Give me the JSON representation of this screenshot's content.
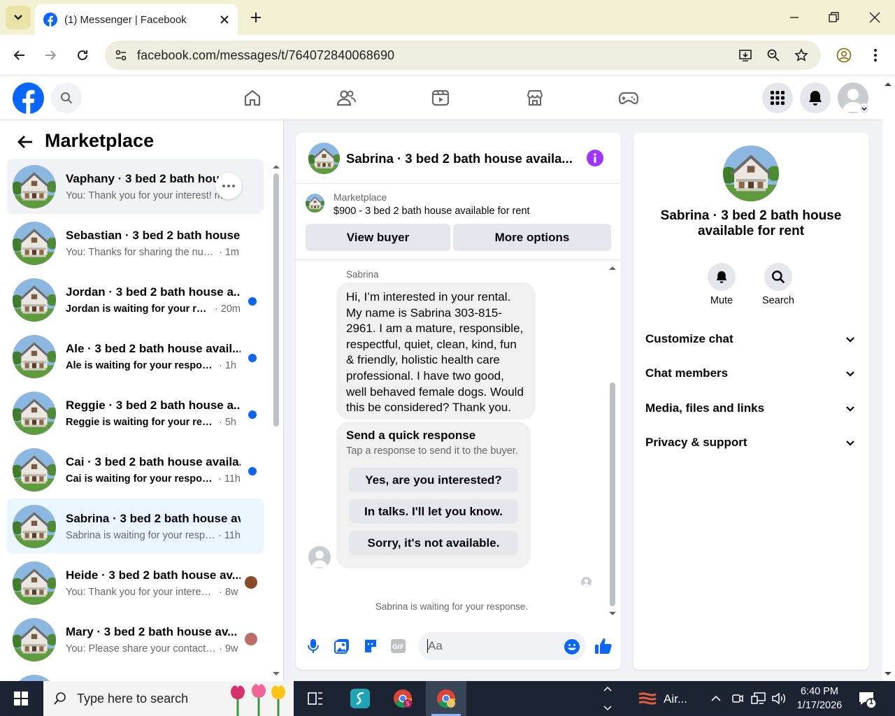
{
  "browser": {
    "tab_title": "(1) Messenger | Facebook",
    "url": "facebook.com/messages/t/764072840068690"
  },
  "sidebar": {
    "title": "Marketplace",
    "conversations": [
      {
        "name": "Vaphany · 3 bed 2 bath hous",
        "preview": "You: Thank you for your interest!",
        "time": "m",
        "unread": false
      },
      {
        "name": "Sebastian · 3 bed 2 bath house ...",
        "preview": "You: Thanks for sharing the numb...",
        "time": "· 1m",
        "unread": false
      },
      {
        "name": "Jordan · 3 bed 2 bath house a...",
        "preview": "Jordan is waiting for your res...",
        "time": "· 20m",
        "unread": true
      },
      {
        "name": "Ale · 3 bed 2 bath house avail...",
        "preview": "Ale is waiting for your response.",
        "time": "· 1h",
        "unread": true
      },
      {
        "name": "Reggie · 3 bed 2 bath house a...",
        "preview": "Reggie is waiting for your respo...",
        "time": "· 5h",
        "unread": true
      },
      {
        "name": "Cai · 3 bed 2 bath house availa...",
        "preview": "Cai is waiting for your response.",
        "time": "· 11h",
        "unread": true
      },
      {
        "name": "Sabrina · 3 bed 2 bath house av...",
        "preview": "Sabrina is waiting for your respon...",
        "time": "· 11h",
        "unread": false
      },
      {
        "name": "Heide · 3 bed 2 bath house av...",
        "preview": "You: Thank you for your interest...",
        "time": "· 8w",
        "unread": false
      },
      {
        "name": "Mary · 3 bed 2 bath house av...",
        "preview": "You: Please share your contact n...",
        "time": "· 9w",
        "unread": false
      }
    ]
  },
  "chat": {
    "header_title": "Sabrina · 3 bed 2 bath house availa...",
    "listing_label": "Marketplace",
    "listing_title": "$900 - 3 bed 2 bath house available for rent",
    "view_buyer": "View buyer",
    "more_options": "More options",
    "sender": "Sabrina",
    "message": "Hi, I’m interested in your rental. My name is Sabrina 303-815-2961.  I am a mature, responsible, respectful, quiet, clean, kind, fun & friendly, holistic health care professional. I have two good, well behaved female dogs. Would this be considered? Thank you.",
    "quick_title": "Send a quick response",
    "quick_sub": "Tap a response to send it to the buyer.",
    "quick_replies": [
      "Yes, are you interested?",
      "In talks. I'll let you know.",
      "Sorry, it's not available."
    ],
    "waiting_text": "Sabrina is waiting for your response.",
    "composer_placeholder": "Aa"
  },
  "info_panel": {
    "title": "Sabrina · 3 bed 2 bath house available for rent",
    "mute_label": "Mute",
    "search_label": "Search",
    "sections": [
      "Customize chat",
      "Chat members",
      "Media, files and links",
      "Privacy & support"
    ]
  },
  "taskbar": {
    "search_placeholder": "Type here to search",
    "weather": "Air...",
    "time": "6:40 PM",
    "date": "1/17/2026",
    "notification_count": "1"
  },
  "colors": {
    "brand": "#0866ff",
    "accent_purple": "#a033ff",
    "chrome_bg": "#f3f0d4"
  }
}
